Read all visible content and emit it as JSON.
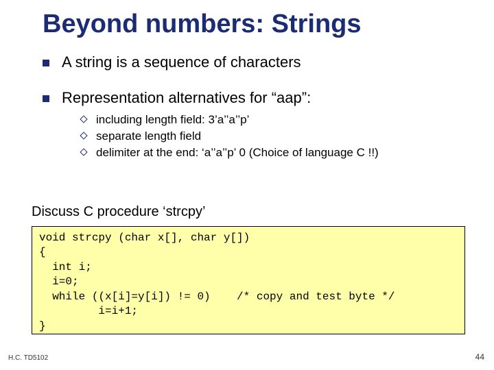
{
  "title": "Beyond numbers: Strings",
  "bullet1": "A string is a sequence of characters",
  "bullet2": "Representation alternatives for “aap”:",
  "sub": {
    "a": "including length field:  3’a’’a’’p’",
    "b": "separate length field",
    "c": "delimiter at the end:  ‘a’’a’’p’ 0   (Choice of language C !!)"
  },
  "discuss": "Discuss C procedure ‘strcpy’",
  "code": "void strcpy (char x[], char y[])\n{\n  int i;\n  i=0;\n  while ((x[i]=y[i]) != 0)    /* copy and test byte */\n         i=i+1;\n}",
  "footer": {
    "left": "H.C. TD5102",
    "right": "44"
  }
}
